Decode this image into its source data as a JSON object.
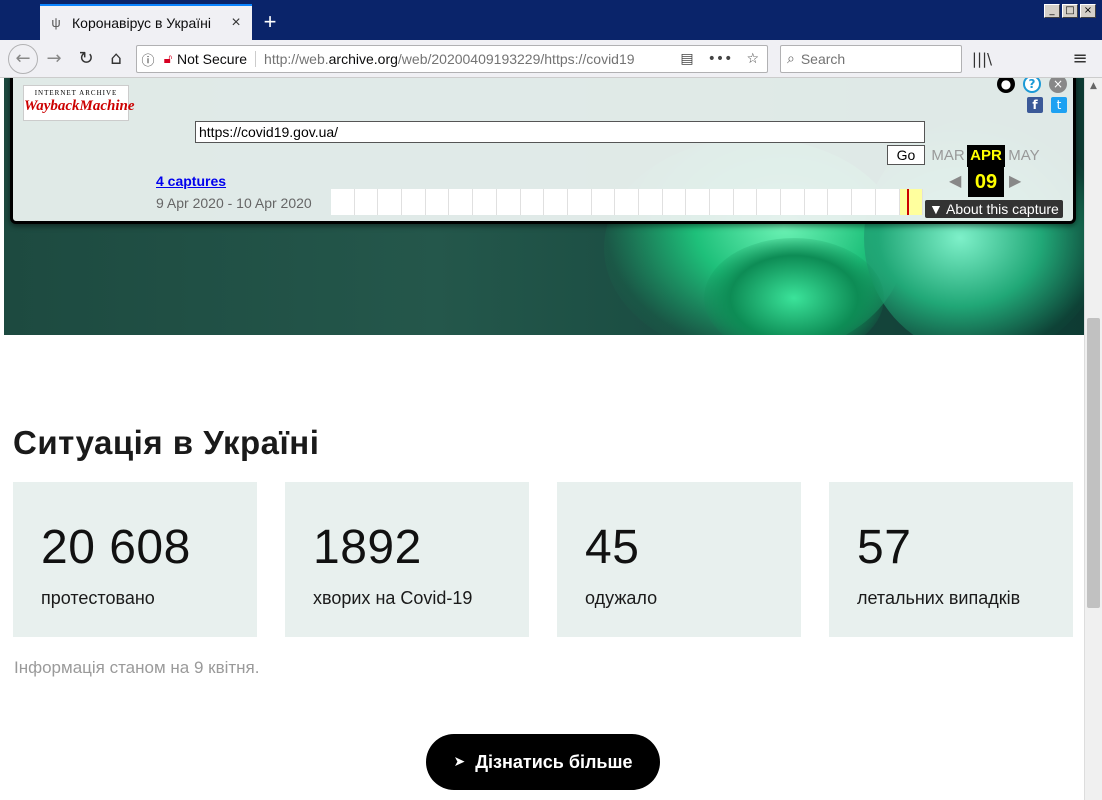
{
  "browser": {
    "tab_title": "Коронавірус в Україні",
    "not_secure": "Not Secure",
    "url_prefix": "http://web.",
    "url_domain": "archive.org",
    "url_rest": "/web/20200409193229/https://covid19",
    "search_placeholder": "Search"
  },
  "wayback": {
    "logo_small": "INTERNET ARCHIVE",
    "logo_big": "WaybackMachine",
    "url_value": "https://covid19.gov.ua/",
    "go_label": "Go",
    "captures": "4 captures",
    "date_range": "9 Apr 2020 - 10 Apr 2020",
    "months": [
      "MAR",
      "APR",
      "MAY"
    ],
    "current_day": "09",
    "about": "About this capture"
  },
  "page": {
    "heading": "Ситуація в Україні",
    "stats": [
      {
        "value": "20 608",
        "label": "протестовано"
      },
      {
        "value": "1892",
        "label": "хворих на Covid-19"
      },
      {
        "value": "45",
        "label": "одужало"
      },
      {
        "value": "57",
        "label": "летальних випадків"
      }
    ],
    "note": "Інформація станом на 9 квітня.",
    "cta": "Дізнатись більше"
  }
}
